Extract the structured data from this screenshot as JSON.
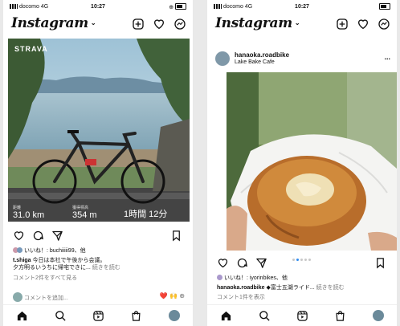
{
  "left": {
    "status": {
      "carrier": "docomo",
      "network": "4G",
      "time": "10:27",
      "battery_glyph": "⊕"
    },
    "app_logo": "Instagram",
    "post": {
      "strava_logo": "STRAVA",
      "stats": [
        {
          "key": "距離",
          "value": "31.0 km"
        },
        {
          "key": "獲得標高",
          "value": "354 m"
        },
        {
          "key": "",
          "value": "1時間 12分"
        }
      ],
      "likes_text": "いいね！: buchiiiii99、他",
      "caption_user": "t.shiga",
      "caption_line1": "今日は本社で午後から会議。",
      "caption_line2": "夕方明るいうちに帰宅できに...",
      "caption_more": "続きを読む",
      "view_comments": "コメント2件をすべて見る",
      "add_comment": "コメントを追加...",
      "reaction_emojis": [
        "❤️",
        "🙌",
        "⊕"
      ]
    }
  },
  "right": {
    "status": {
      "carrier": "docomo",
      "network": "4G",
      "time": "10:27"
    },
    "app_logo": "Instagram",
    "post": {
      "username": "hanaoka.roadbike",
      "location": "Lake Bake Cafe",
      "more": "...",
      "likes_text": "いいね！: iyorinbikes、他",
      "caption_user": "hanaoka.roadbike",
      "caption_text": "◆富士五湖ライド...",
      "caption_more": "続きを読む",
      "view_comments": "コメント1件を表示",
      "carousel_index": 2,
      "carousel_count": 5
    }
  },
  "colors": {
    "accent": "#2f8cf0",
    "like_red": "#e0245e"
  }
}
